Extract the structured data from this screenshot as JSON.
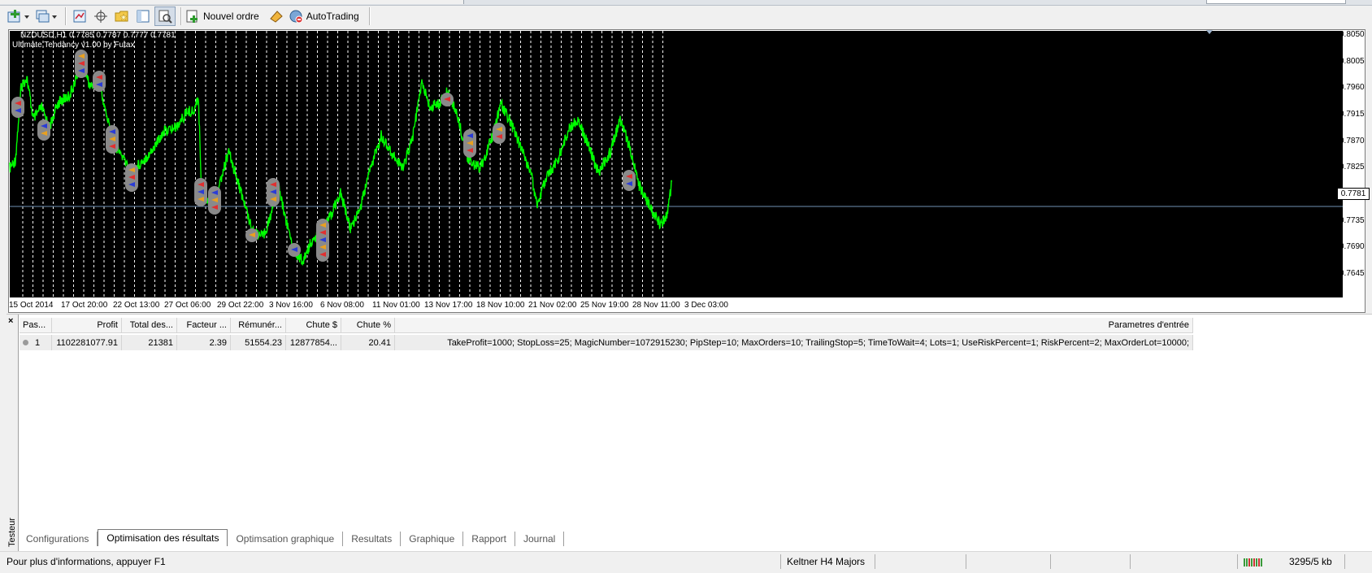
{
  "toolbar": {
    "new_order_label": "Nouvel ordre",
    "autotrading_label": "AutoTrading",
    "icons": [
      "new-chart-icon",
      "profiles-icon",
      "zoom-chart-icon",
      "crosshair-icon",
      "folder-star-icon",
      "navigator-icon",
      "tester-icon",
      "new-order-icon",
      "metaeditor-icon",
      "autotrading-icon"
    ]
  },
  "chart": {
    "symbol_line": "NZDUSD,H1  0.7785 0.7787 0.7777 0.7781",
    "indicator_line": "Ultimate Tendancy v1.00 by Futax",
    "current_price": "0.7781",
    "price_labels": [
      "0.8050",
      "0.8005",
      "0.7960",
      "0.7915",
      "0.7870",
      "0.7825",
      "0.7735",
      "0.7690",
      "0.7645"
    ],
    "date_labels": [
      "15 Oct 2014",
      "17 Oct 20:00",
      "22 Oct 13:00",
      "27 Oct 06:00",
      "29 Oct 22:00",
      "3 Nov 16:00",
      "6 Nov 08:00",
      "11 Nov 01:00",
      "13 Nov 17:00",
      "18 Nov 10:00",
      "21 Nov 02:00",
      "25 Nov 19:00",
      "28 Nov 11:00",
      "3 Dec 03:00"
    ],
    "colors": {
      "background": "#000000",
      "price_line": "#00ff00",
      "grid": "#ffffff",
      "current_line": "#6f8fb5"
    }
  },
  "tester": {
    "side_label": "Testeur",
    "columns": [
      "Pas...",
      "Profit",
      "Total des...",
      "Facteur ...",
      "Rémunér...",
      "Chute $",
      "Chute %",
      "Parametres d'entrée"
    ],
    "rows": [
      {
        "pass": "1",
        "profit": "1102281077.91",
        "total": "21381",
        "factor": "2.39",
        "payoff": "51554.23",
        "dd_money": "12877854...",
        "dd_percent": "20.41",
        "params": "TakeProfit=1000; StopLoss=25; MagicNumber=1072915230; PipStep=10; MaxOrders=10; TrailingStop=5; TimeToWait=4; Lots=1; UseRiskPercent=1; RiskPercent=2; MaxOrderLot=10000;"
      }
    ],
    "tabs": [
      "Configurations",
      "Optimisation des résultats",
      "Optimsation graphique",
      "Resultats",
      "Graphique",
      "Rapport",
      "Journal"
    ],
    "active_tab": "Optimisation des résultats"
  },
  "status": {
    "help_text": "Pour plus d'informations, appuyer F1",
    "profile": "Keltner H4 Majors",
    "traffic": "3295/5 kb"
  }
}
